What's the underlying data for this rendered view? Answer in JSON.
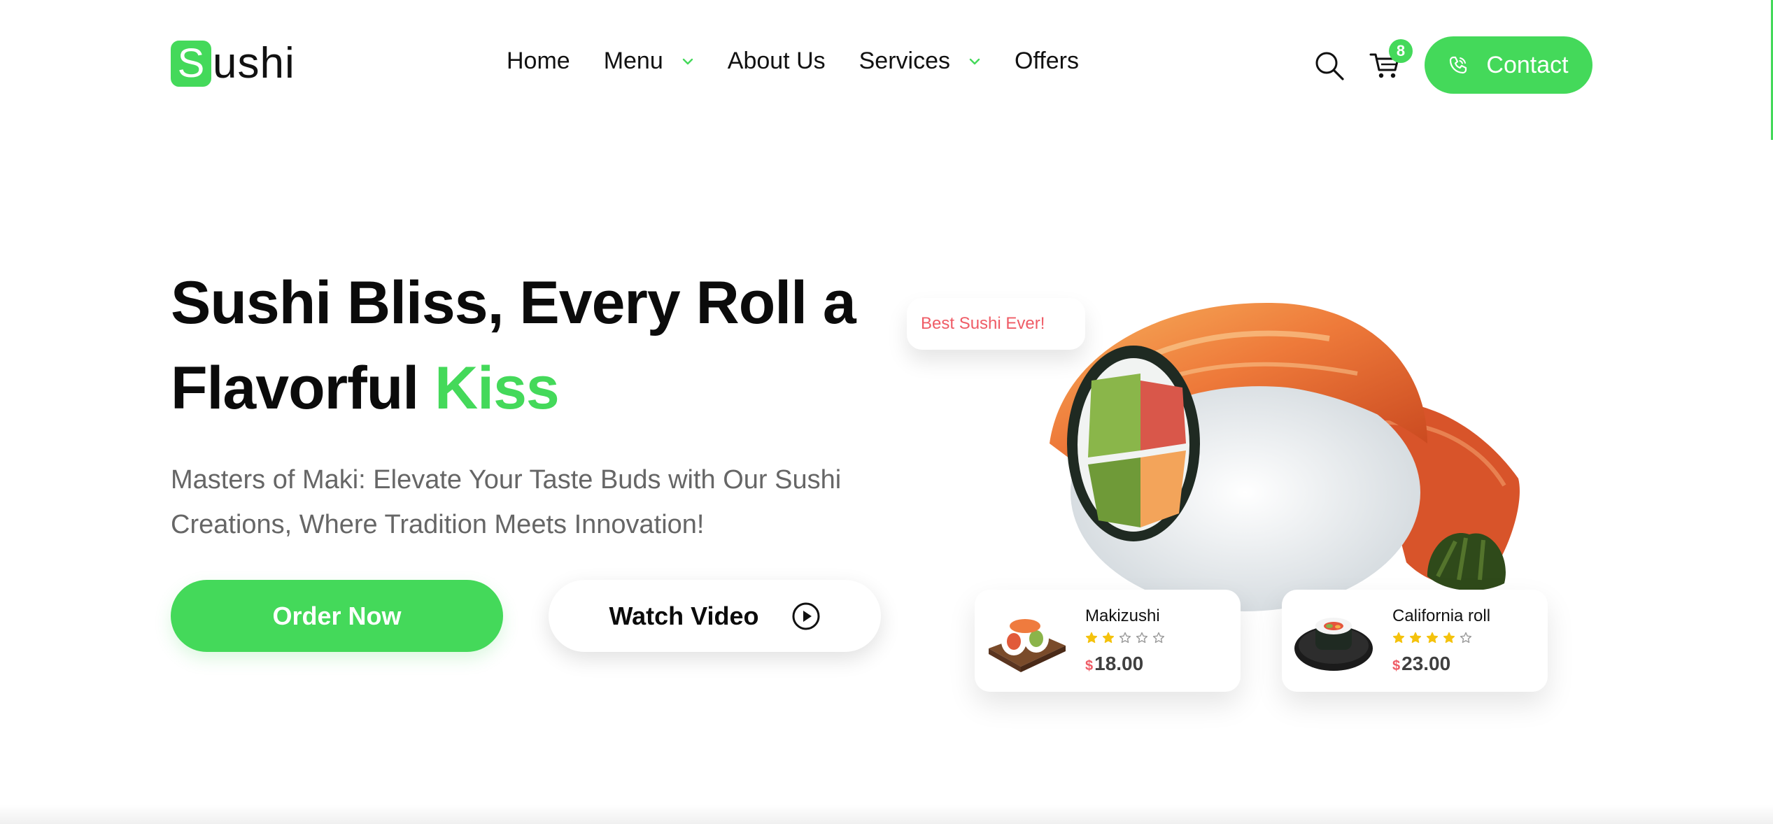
{
  "brand": {
    "logo_letter": "S",
    "logo_rest": "ushi",
    "accent_color": "#44d95a",
    "price_currency_color": "#ef5c66"
  },
  "nav": {
    "items": [
      {
        "label": "Home",
        "has_dropdown": false
      },
      {
        "label": "Menu",
        "has_dropdown": true
      },
      {
        "label": "About Us",
        "has_dropdown": false
      },
      {
        "label": "Services",
        "has_dropdown": true
      },
      {
        "label": "Offers",
        "has_dropdown": false
      }
    ]
  },
  "header_actions": {
    "search_icon": "search-icon",
    "cart_icon": "cart-icon",
    "cart_count": "8",
    "contact_label": "Contact",
    "contact_icon": "phone-icon"
  },
  "hero": {
    "title_line1": "Sushi Bliss, Every Roll a",
    "title_line2_main": "Flavorful",
    "title_line2_accent": "Kiss",
    "subtitle": "Masters of Maki: Elevate Your Taste Buds with Our Sushi Creations, Where Tradition Meets Innovation!",
    "order_button": "Order Now",
    "watch_button": "Watch Video",
    "bubble_text": "Best Sushi Ever!"
  },
  "products": [
    {
      "name": "Makizushi",
      "rating": 2,
      "max_rating": 5,
      "currency": "$",
      "price": "18.00"
    },
    {
      "name": "California roll",
      "rating": 4,
      "max_rating": 5,
      "currency": "$",
      "price": "23.00"
    }
  ]
}
